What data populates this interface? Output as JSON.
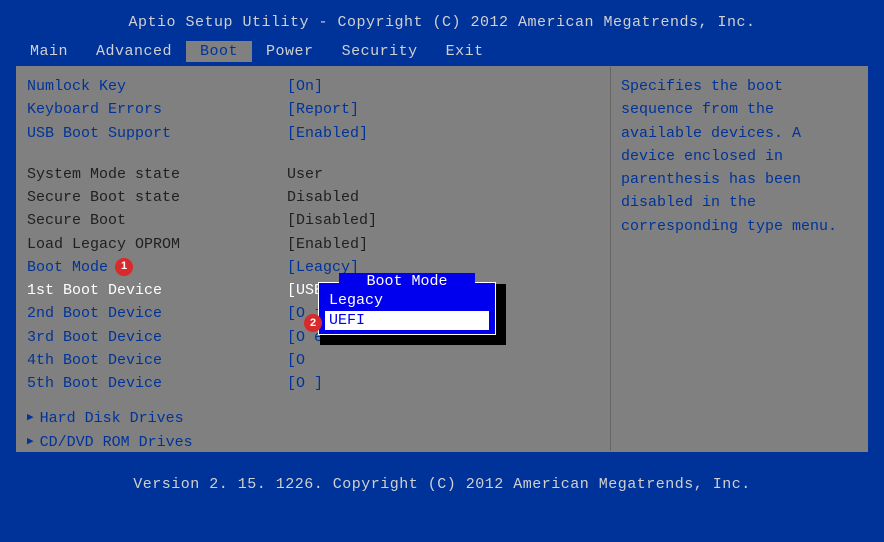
{
  "header": "Aptio Setup Utility - Copyright (C) 2012 American Megatrends, Inc.",
  "tabs": [
    "Main",
    "Advanced",
    "Boot",
    "Power",
    "Security",
    "Exit"
  ],
  "active_tab": "Boot",
  "settings": {
    "numlock": {
      "label": "Numlock Key",
      "value": "[On]"
    },
    "keyboard_errors": {
      "label": "Keyboard Errors",
      "value": "[Report]"
    },
    "usb_boot": {
      "label": "USB Boot Support",
      "value": "[Enabled]"
    },
    "system_mode": {
      "label": "System Mode state",
      "value": "User"
    },
    "secure_boot_state": {
      "label": "Secure Boot state",
      "value": "Disabled"
    },
    "secure_boot": {
      "label": "Secure Boot",
      "value": "[Disabled]"
    },
    "load_legacy": {
      "label": "Load Legacy OPROM",
      "value": "[Enabled]"
    },
    "boot_mode": {
      "label": "Boot Mode",
      "value": "[Leagcy]"
    },
    "first_boot": {
      "label": "1st Boot Device",
      "value": "[USB Storage Device]"
    },
    "second_boot": {
      "label": "2nd Boot Device",
      "value": "[O            ices: P...]"
    },
    "third_boot": {
      "label": "3rd Boot Device",
      "value": "[O             es: W...]"
    },
    "fourth_boot": {
      "label": "4th Boot Device",
      "value": "[O"
    },
    "fifth_boot": {
      "label": "5th Boot Device",
      "value": "[O               ]"
    }
  },
  "submenus": {
    "hdd": "Hard Disk Drives",
    "cddvd": "CD/DVD ROM Drives"
  },
  "popup": {
    "title": "Boot Mode",
    "items": [
      "Legacy",
      "UEFI"
    ],
    "selected": "UEFI"
  },
  "help": "Specifies the boot sequence from the available devices. A device enclosed in parenthesis has been disabled in the corresponding type menu.",
  "footer": "Version 2. 15. 1226. Copyright (C) 2012 American Megatrends, Inc.",
  "badges": {
    "1": "1",
    "2": "2"
  }
}
